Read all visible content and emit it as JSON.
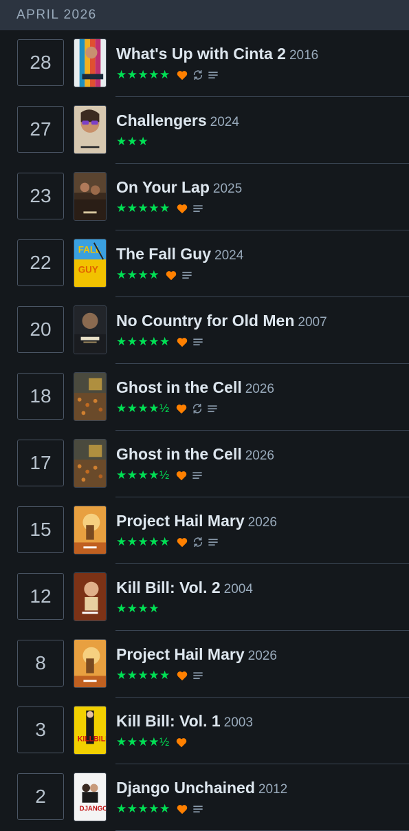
{
  "header": {
    "month": "APRIL 2026"
  },
  "colors": {
    "accent_star": "#00e054",
    "heart": "#ff8000",
    "icon_grey": "#8899aa"
  },
  "entries": [
    {
      "day": "28",
      "title": "What's Up with Cinta 2",
      "year": "2016",
      "rating": "★★★★★",
      "liked": true,
      "rewatch": true,
      "review": true,
      "poster": "cinta"
    },
    {
      "day": "27",
      "title": "Challengers",
      "year": "2024",
      "rating": "★★★",
      "liked": false,
      "rewatch": false,
      "review": false,
      "poster": "challengers"
    },
    {
      "day": "23",
      "title": "On Your Lap",
      "year": "2025",
      "rating": "★★★★★",
      "liked": true,
      "rewatch": false,
      "review": true,
      "poster": "lap"
    },
    {
      "day": "22",
      "title": "The Fall Guy",
      "year": "2024",
      "rating": "★★★★",
      "liked": true,
      "rewatch": false,
      "review": true,
      "poster": "fallguy"
    },
    {
      "day": "20",
      "title": "No Country for Old Men",
      "year": "2007",
      "rating": "★★★★★",
      "liked": true,
      "rewatch": false,
      "review": true,
      "poster": "nocountry"
    },
    {
      "day": "18",
      "title": "Ghost in the Cell",
      "year": "2026",
      "rating": "★★★★½",
      "liked": true,
      "rewatch": true,
      "review": true,
      "poster": "ghost"
    },
    {
      "day": "17",
      "title": "Ghost in the Cell",
      "year": "2026",
      "rating": "★★★★½",
      "liked": true,
      "rewatch": false,
      "review": true,
      "poster": "ghost"
    },
    {
      "day": "15",
      "title": "Project Hail Mary",
      "year": "2026",
      "rating": "★★★★★",
      "liked": true,
      "rewatch": true,
      "review": true,
      "poster": "hailmary"
    },
    {
      "day": "12",
      "title": "Kill Bill: Vol. 2",
      "year": "2004",
      "rating": "★★★★",
      "liked": false,
      "rewatch": false,
      "review": false,
      "poster": "killbill2"
    },
    {
      "day": "8",
      "title": "Project Hail Mary",
      "year": "2026",
      "rating": "★★★★★",
      "liked": true,
      "rewatch": false,
      "review": true,
      "poster": "hailmary"
    },
    {
      "day": "3",
      "title": "Kill Bill: Vol. 1",
      "year": "2003",
      "rating": "★★★★½",
      "liked": true,
      "rewatch": false,
      "review": false,
      "poster": "killbill1"
    },
    {
      "day": "2",
      "title": "Django Unchained",
      "year": "2012",
      "rating": "★★★★★",
      "liked": true,
      "rewatch": false,
      "review": true,
      "poster": "django"
    }
  ]
}
